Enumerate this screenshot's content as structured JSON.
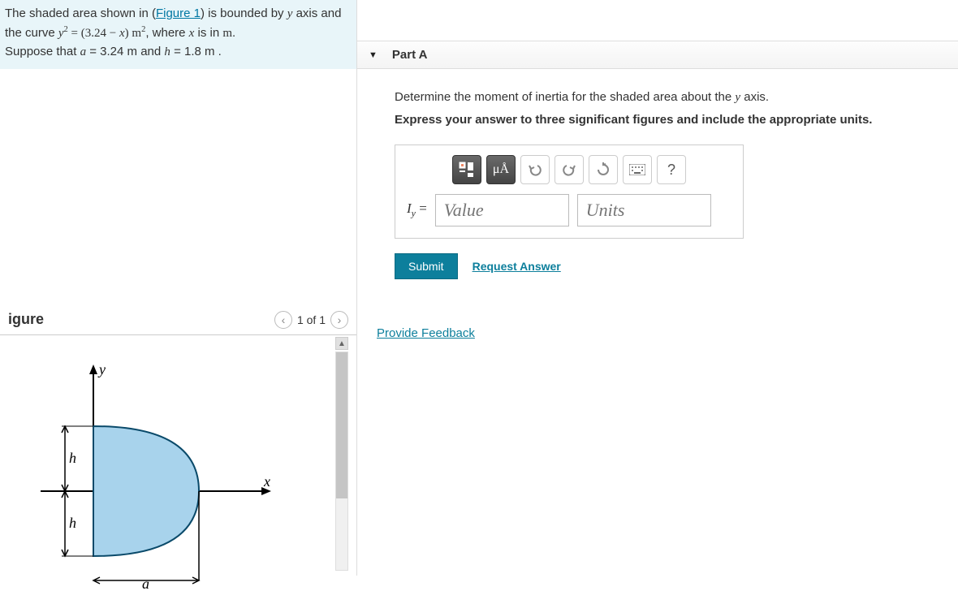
{
  "prompt": {
    "pre": "The shaded area shown in (",
    "figure_link": "Figure 1",
    "post": ") is bounded by ",
    "y_axis": "y",
    "after_y": " axis and the curve ",
    "eq_y2": "y",
    "eq_sup": "2",
    "eq_mid": " = (3.24 − ",
    "eq_x": "x",
    "eq_close": ") ",
    "eq_unit_m": "m",
    "eq_unit_sup": "2",
    "eq_where": ", where ",
    "eq_x2": "x",
    "eq_isin": " is in ",
    "eq_m": "m",
    "eq_period": ". ",
    "suppose": "Suppose that ",
    "a_var": "a",
    "a_val": " = 3.24  m and ",
    "h_var": "h",
    "h_val": " = 1.8  m .",
    "values": {
      "a": 3.24,
      "h": 1.8
    }
  },
  "figure": {
    "title": "igure",
    "page_text": "1 of 1",
    "labels": {
      "y": "y",
      "x": "x",
      "h": "h",
      "a": "a"
    }
  },
  "part": {
    "header": "Part A",
    "desc_pre": "Determine the moment of inertia for the shaded area about the ",
    "desc_y": "y",
    "desc_post": " axis.",
    "instruction": "Express your answer to three significant figures and include the appropriate units.",
    "toolbar": {
      "templates_icon": "templates-icon",
      "mu_label": "μÅ",
      "undo_icon": "undo-icon",
      "redo_icon": "redo-icon",
      "reset_icon": "reset-icon",
      "keyboard_icon": "keyboard-icon",
      "help_label": "?"
    },
    "lhs": {
      "sym": "I",
      "sub": "y",
      "eq": " = "
    },
    "value_placeholder": "Value",
    "units_placeholder": "Units",
    "submit": "Submit",
    "request": "Request Answer"
  },
  "feedback": "Provide Feedback"
}
